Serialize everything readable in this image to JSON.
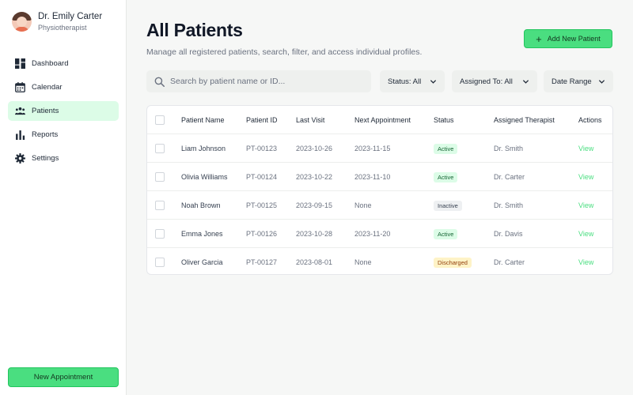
{
  "profile": {
    "name": "Dr. Emily Carter",
    "role": "Physiotherapist"
  },
  "nav": {
    "items": [
      {
        "label": "Dashboard",
        "icon": "dashboard-icon"
      },
      {
        "label": "Calendar",
        "icon": "calendar-icon"
      },
      {
        "label": "Patients",
        "icon": "patients-icon",
        "active": true
      },
      {
        "label": "Reports",
        "icon": "bar-chart-icon"
      },
      {
        "label": "Settings",
        "icon": "gear-icon"
      }
    ]
  },
  "sidebar": {
    "new_appointment_label": "New Appointment"
  },
  "header": {
    "title": "All Patients",
    "subtitle": "Manage all registered patients, search, filter, and access individual profiles.",
    "add_button_label": "Add New Patient"
  },
  "search": {
    "placeholder": "Search by patient name or ID..."
  },
  "filters": {
    "status": "Status: All",
    "assigned_to": "Assigned To: All",
    "date_range": "Date Range"
  },
  "table": {
    "columns": {
      "patient_name": "Patient Name",
      "patient_id": "Patient ID",
      "last_visit": "Last Visit",
      "next_appointment": "Next Appointment",
      "status": "Status",
      "assigned_therapist": "Assigned Therapist",
      "actions": "Actions"
    },
    "rows": [
      {
        "name": "Liam Johnson",
        "id": "PT-00123",
        "last_visit": "2023-10-26",
        "next_appointment": "2023-11-15",
        "status": "Active",
        "therapist": "Dr. Smith",
        "action": "View"
      },
      {
        "name": "Olivia Williams",
        "id": "PT-00124",
        "last_visit": "2023-10-22",
        "next_appointment": "2023-11-10",
        "status": "Active",
        "therapist": "Dr. Carter",
        "action": "View"
      },
      {
        "name": "Noah Brown",
        "id": "PT-00125",
        "last_visit": "2023-09-15",
        "next_appointment": "None",
        "status": "Inactive",
        "therapist": "Dr. Smith",
        "action": "View"
      },
      {
        "name": "Emma Jones",
        "id": "PT-00126",
        "last_visit": "2023-10-28",
        "next_appointment": "2023-11-20",
        "status": "Active",
        "therapist": "Dr. Davis",
        "action": "View"
      },
      {
        "name": "Oliver Garcia",
        "id": "PT-00127",
        "last_visit": "2023-08-01",
        "next_appointment": "None",
        "status": "Discharged",
        "therapist": "Dr. Carter",
        "action": "View"
      }
    ]
  },
  "colors": {
    "accent": "#4ade80",
    "accent_light": "#dcfce7",
    "status_active": "#dcfce7",
    "status_inactive": "#eef0f2",
    "status_discharged": "#fef3c7"
  }
}
